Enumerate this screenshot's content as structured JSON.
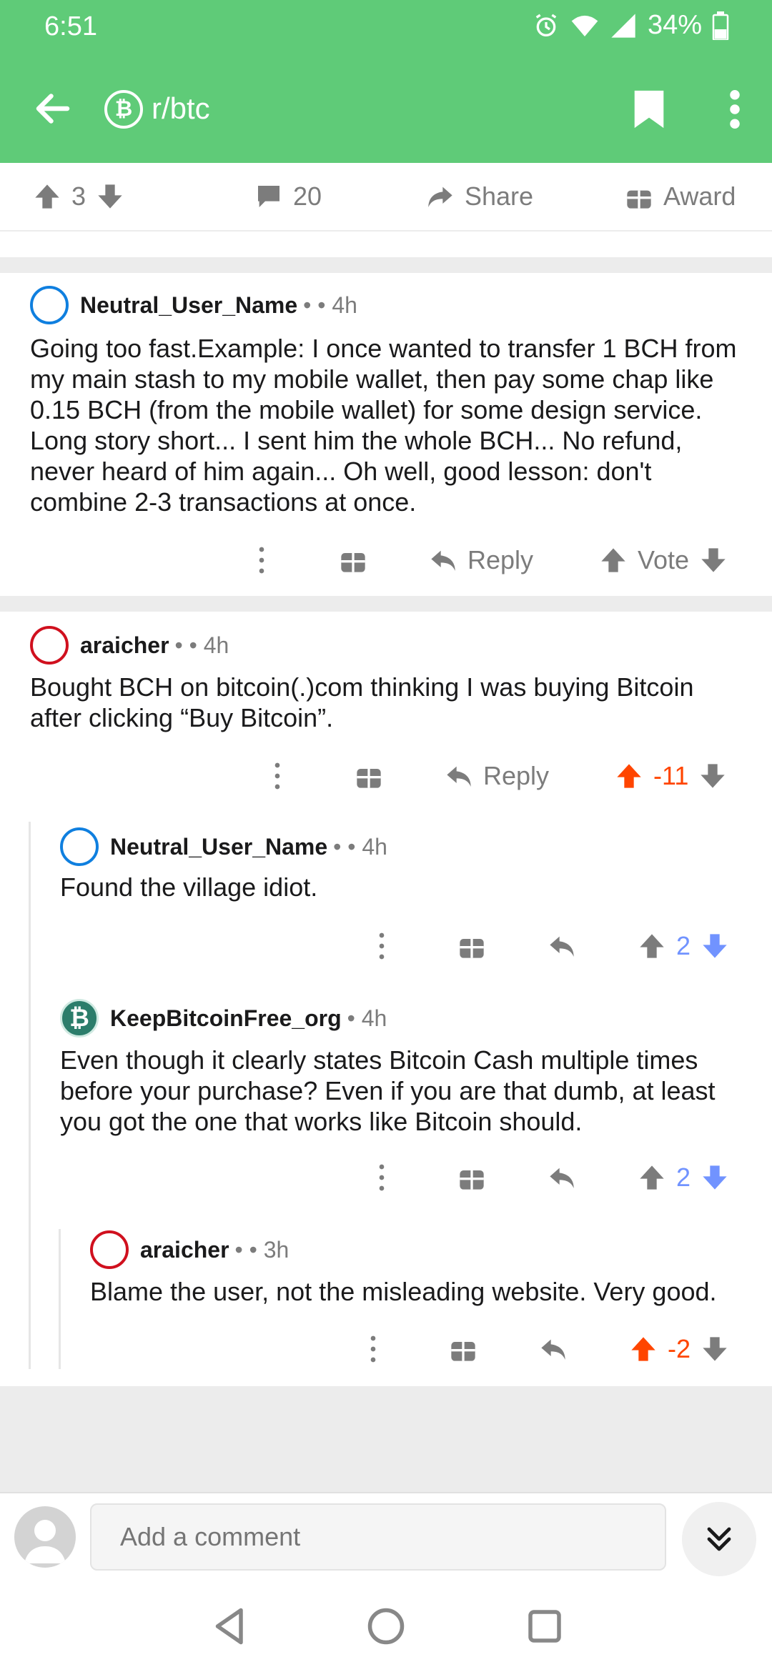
{
  "status": {
    "time": "6:51",
    "battery": "34%"
  },
  "appbar": {
    "subreddit": "r/btc",
    "sub_icon_glyph": "₿"
  },
  "post_actions": {
    "score": "3",
    "comments": "20",
    "share": "Share",
    "award": "Award"
  },
  "comments": [
    {
      "user": "Neutral_User_Name",
      "meta": "• • 4h",
      "body": "Going too fast.Example: I once wanted to transfer 1 BCH from my main stash to my mobile wallet, then pay some chap like 0.15 BCH (from the mobile wallet) for some design service. Long story short... I sent him the whole BCH... No refund, never heard of him again... Oh well, good lesson: don't combine 2-3 transactions at once.",
      "reply": "Reply",
      "vote": "Vote"
    },
    {
      "user": "araicher",
      "meta": "• • 4h",
      "body": "Bought BCH on bitcoin(.)com thinking I was buying Bitcoin after clicking “Buy Bitcoin”.",
      "reply": "Reply",
      "score": "-11"
    },
    {
      "user": "Neutral_User_Name",
      "meta": "• • 4h",
      "body": "Found the village idiot.",
      "score": "2"
    },
    {
      "user": "KeepBitcoinFree_org",
      "meta": "• 4h",
      "body": "Even though it clearly states Bitcoin Cash multiple times before your purchase? Even if you are that dumb, at least you got the one that works like Bitcoin should.",
      "score": "2"
    },
    {
      "user": "araicher",
      "meta": "• • 3h",
      "body": "Blame the user, not the misleading website. Very good.",
      "score": "-2"
    }
  ],
  "add_comment": {
    "placeholder": "Add a comment"
  },
  "colors": {
    "header": "#5fcb78",
    "upvote": "#ff4500",
    "downvote": "#7193ff",
    "muted": "#7c7c7c"
  }
}
